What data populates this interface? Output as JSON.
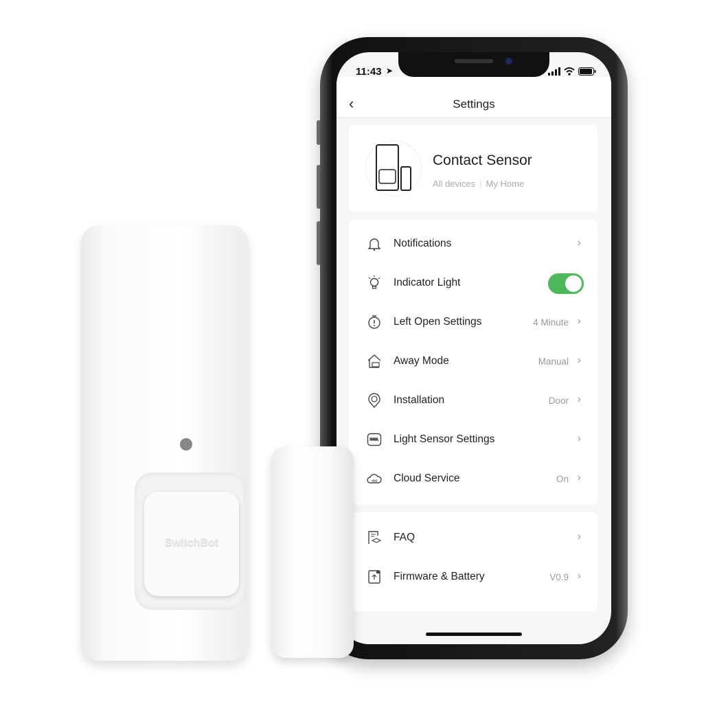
{
  "status_bar": {
    "time": "11:43"
  },
  "header": {
    "title": "Settings"
  },
  "device": {
    "name": "Contact Sensor",
    "location": "All devices",
    "room": "My Home",
    "brand_logo": "SwitchBot"
  },
  "settings": [
    {
      "icon": "bell-icon",
      "label": "Notifications",
      "value": ""
    },
    {
      "icon": "bulb-icon",
      "label": "Indicator Light",
      "toggle": true
    },
    {
      "icon": "timer-icon",
      "label": "Left Open Settings",
      "value": "4 Minute"
    },
    {
      "icon": "home-icon",
      "label": "Away Mode",
      "value": "Manual"
    },
    {
      "icon": "location-pin-icon",
      "label": "Installation",
      "value": "Door"
    },
    {
      "icon": "light-sensor-icon",
      "label": "Light Sensor Settings",
      "value": ""
    },
    {
      "icon": "cloud-icon",
      "label": "Cloud Service",
      "value": "On"
    }
  ],
  "more": [
    {
      "icon": "faq-icon",
      "label": "FAQ",
      "value": ""
    },
    {
      "icon": "firmware-icon",
      "label": "Firmware & Battery",
      "value": "V0.9"
    }
  ],
  "colors": {
    "toggle_on": "#4cb85a"
  }
}
